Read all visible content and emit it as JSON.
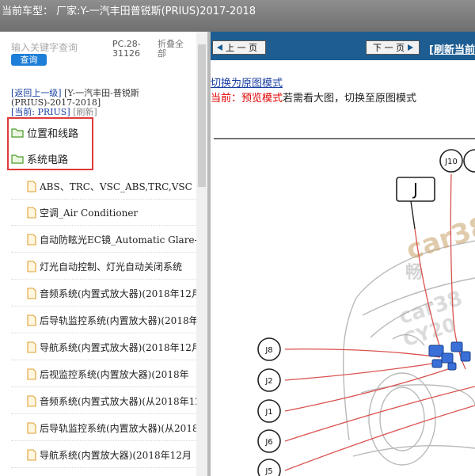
{
  "window": {
    "title": "当前车型：  厂家:Y-一汽丰田普锐斯(PRIUS)2017-2018"
  },
  "sidebar": {
    "search": {
      "placeholder": "输入关键字查询",
      "button_label": "查询"
    },
    "pc_code": "PC.28-31126",
    "collapse_label": "折叠全部",
    "breadcrumb": {
      "back_label": "[返回上一级]",
      "model_text": "[Y-一汽丰田-普锐斯(PRIUS)-2017-2018]",
      "current_prefix": "[当前:",
      "current_value": "PRIUS]",
      "refresh_label": "[刷新]"
    },
    "folders": [
      {
        "label": "位置和线路"
      },
      {
        "label": "系统电路"
      }
    ],
    "files": [
      {
        "label": "ABS、TRC、VSC_ABS,TRC,VSC"
      },
      {
        "label": "空调_Air Conditioner"
      },
      {
        "label": "自动防眩光EC镜_Automatic Glare-Resistant EC Mirror"
      },
      {
        "label": "灯光自动控制、灯光自动关闭系统"
      },
      {
        "label": "音频系统(内置式放大器)(2018年12月"
      },
      {
        "label": "后导轨监控系统(内置放大器)(2018年"
      },
      {
        "label": "导航系统(内置式放大器)(2018年12月"
      },
      {
        "label": "后视监控系统(内置放大器)(2018年"
      },
      {
        "label": "音频系统(内置式放大器)(从2018年12月"
      },
      {
        "label": "后导轨监控系统(内置放大器)(从2018年"
      },
      {
        "label": "导航系统(内置放大器)(2018年12月"
      }
    ]
  },
  "viewer": {
    "prev_label": "上 一 页",
    "next_label": "下 一 页",
    "refresh_label": "[刷新当前",
    "switch_link": "切换为原图模式",
    "mode_current_label": "当前：预览模式",
    "mode_hint": "若需看大图，切换至原图模式",
    "diagram": {
      "connectors": [
        "J10",
        "J",
        "J8",
        "J2",
        "J1",
        "J6",
        "J5"
      ],
      "watermark": [
        "car38",
        "畅",
        "car38",
        "CY20"
      ]
    }
  },
  "colors": {
    "accent_blue": "#1e7fd8",
    "nav_blue": "#1d5d92",
    "highlight_red": "#e03a3a",
    "mode_red": "#e00000",
    "wire_red": "#d9534f"
  }
}
